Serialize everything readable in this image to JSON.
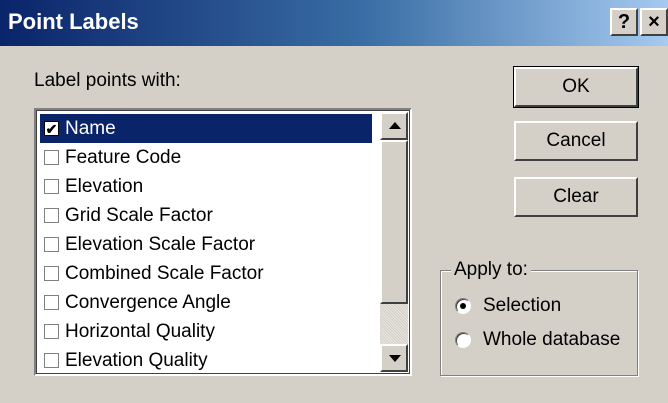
{
  "window": {
    "title": "Point Labels",
    "help_label": "?",
    "close_label": "×"
  },
  "label_prompt": "Label points with:",
  "list": {
    "items": [
      {
        "label": "Name",
        "checked": true,
        "selected": true
      },
      {
        "label": "Feature Code",
        "checked": false,
        "selected": false
      },
      {
        "label": "Elevation",
        "checked": false,
        "selected": false
      },
      {
        "label": "Grid Scale Factor",
        "checked": false,
        "selected": false
      },
      {
        "label": "Elevation Scale Factor",
        "checked": false,
        "selected": false
      },
      {
        "label": "Combined Scale Factor",
        "checked": false,
        "selected": false
      },
      {
        "label": "Convergence Angle",
        "checked": false,
        "selected": false
      },
      {
        "label": "Horizontal Quality",
        "checked": false,
        "selected": false
      },
      {
        "label": "Elevation Quality",
        "checked": false,
        "selected": false
      }
    ]
  },
  "buttons": {
    "ok": "OK",
    "cancel": "Cancel",
    "clear": "Clear"
  },
  "apply_to": {
    "legend": "Apply to:",
    "options": [
      {
        "label": "Selection",
        "selected": true
      },
      {
        "label": "Whole database",
        "selected": false
      }
    ]
  },
  "colors": {
    "title_start": "#0a246a",
    "title_end": "#a6caf0",
    "face": "#d4d0c8",
    "selection": "#0a246a"
  },
  "icons": {
    "help": "help-icon",
    "close": "close-icon",
    "check": "check-icon",
    "scroll_up": "arrow-up-icon",
    "scroll_down": "arrow-down-icon"
  }
}
